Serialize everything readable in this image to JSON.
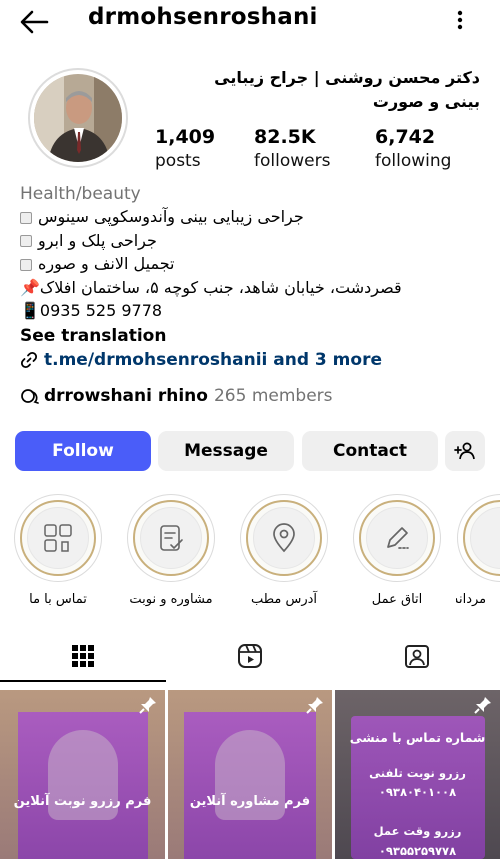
{
  "header": {
    "username": "drmohsenroshani"
  },
  "profile": {
    "display_name": "دکتر محسن روشنی | جراح زیبایی بینی و صورت",
    "stats": [
      {
        "value": "1,409",
        "label": "posts"
      },
      {
        "value": "82.5K",
        "label": "followers"
      },
      {
        "value": "6,742",
        "label": "following"
      }
    ]
  },
  "bio": {
    "category": "Health/beauty",
    "lines": [
      "جراحی زیبایی بینی وآندوسکوپی سینوس",
      "جراحی پلک و ابرو",
      "تجمیل الانف و صوره",
      "قصردشت، خیابان شاهد، جنب کوچه ۵، ساختمان افلاک📌",
      "📱0935 525 9778"
    ],
    "see_translation": "See translation",
    "link_text": "t.me/drmohsenroshanii and 3 more",
    "thread_name": "drrowshani rhino",
    "thread_members": "265 members"
  },
  "actions": {
    "follow": "Follow",
    "message": "Message",
    "contact": "Contact"
  },
  "highlights": [
    {
      "label": "تماس با ما",
      "icon": "contact-icon"
    },
    {
      "label": "مشاوره و نوبت",
      "icon": "consult-icon"
    },
    {
      "label": "آدرس مطب",
      "icon": "location-icon"
    },
    {
      "label": "اتاق عمل",
      "icon": "pen-icon"
    },
    {
      "label": "مردانه",
      "icon": "highlight-icon"
    }
  ],
  "tabs": [
    {
      "name": "grid",
      "icon": "grid-icon",
      "active": true
    },
    {
      "name": "reels",
      "icon": "reels-icon",
      "active": false
    },
    {
      "name": "tagged",
      "icon": "tagged-icon",
      "active": false
    }
  ],
  "posts": [
    {
      "caption": "فرم رزرو نوبت آنلاین",
      "pinned": true
    },
    {
      "caption": "فرم مشاوره آنلاین",
      "pinned": true
    },
    {
      "lines": [
        "شماره تماس با منشی",
        "رزرو نوبت تلفنی",
        "۰۹۳۸۰۴۰۱۰۰۸",
        "رزرو وقت عمل",
        "۰۹۳۵۵۲۵۹۷۷۸"
      ],
      "pinned": true
    }
  ],
  "colors": {
    "follow_button": "#4a5df9",
    "secondary_button": "#efefef",
    "highlight_ring": "#c9b07c",
    "muted_text": "#737373"
  }
}
